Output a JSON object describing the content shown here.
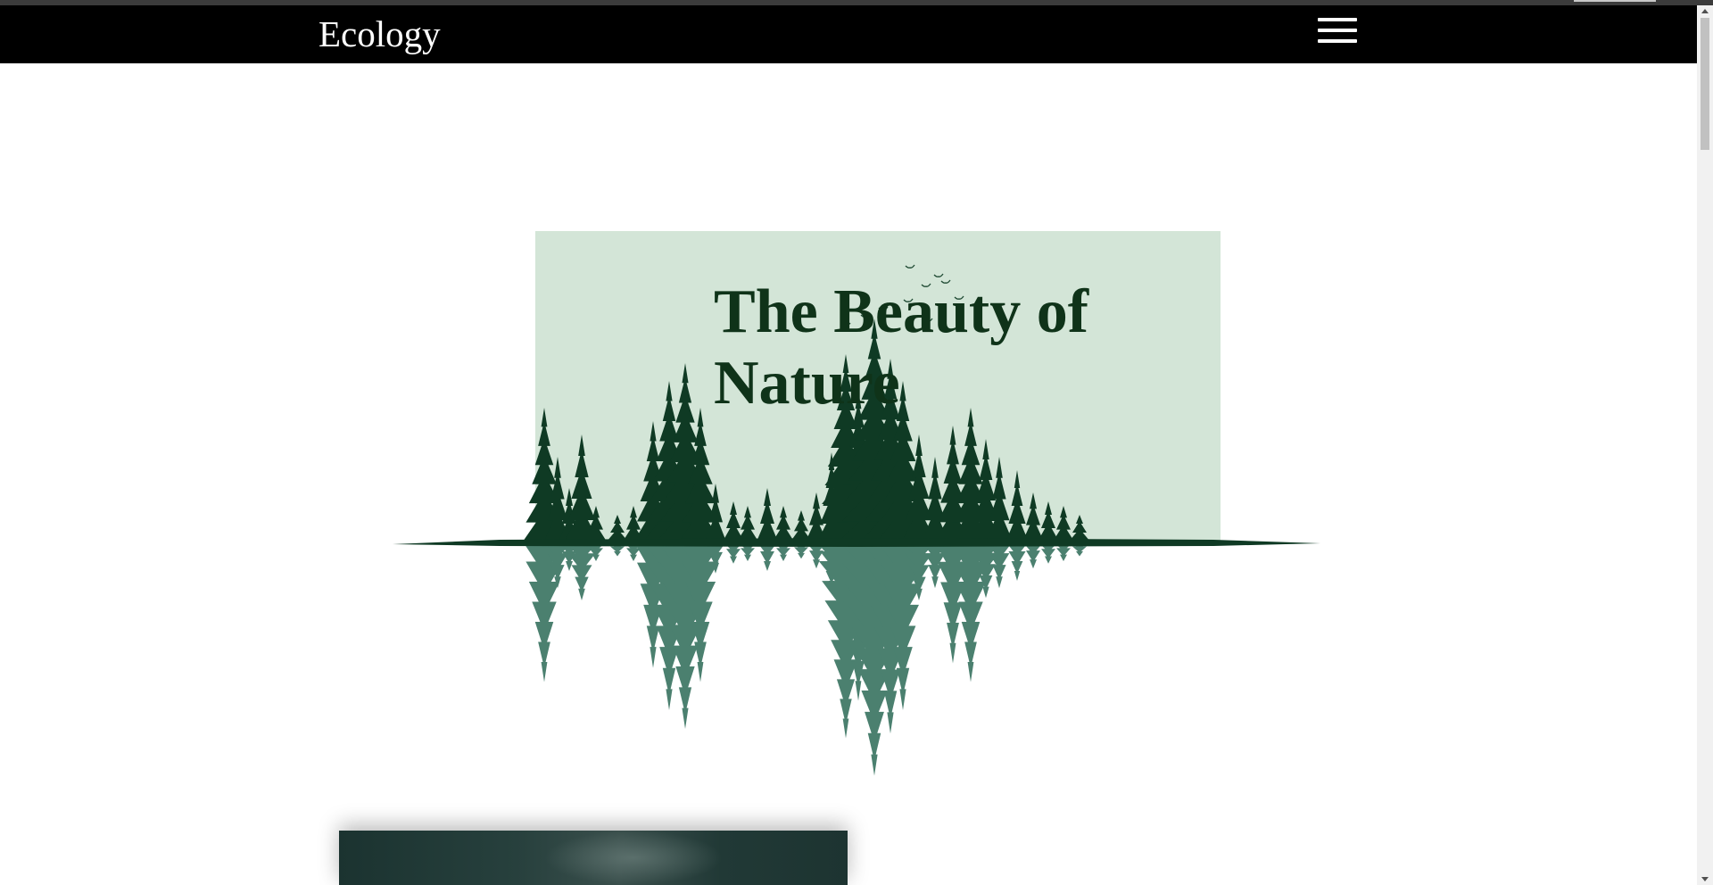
{
  "navbar": {
    "brand": "Ecology",
    "menu_icon": "hamburger-menu-icon"
  },
  "hero": {
    "title": "The Beauty of Nature",
    "illustration": "forest-reflection-illustration"
  },
  "colors": {
    "navbar_bg": "#000000",
    "hero_panel": "#d3e5d7",
    "title_color": "#0f3319",
    "forest_dark": "#0f3a24",
    "reflection": "#2c6a57"
  },
  "content": {
    "card_image": "dark-forest-photo"
  }
}
